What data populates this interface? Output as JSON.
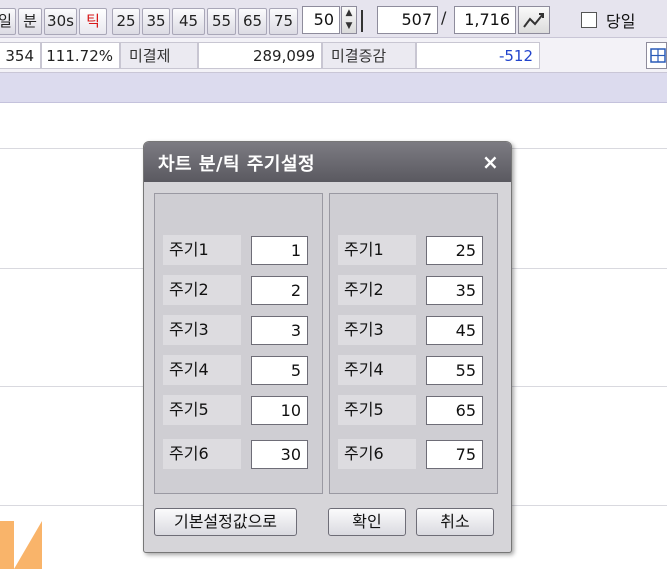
{
  "toolbar": {
    "period_buttons": [
      "일",
      "분",
      "30s",
      "틱",
      "25",
      "35",
      "45",
      "55",
      "65",
      "75"
    ],
    "count_value": "50",
    "current_value": "507",
    "total_value": "1,716",
    "slash": "/",
    "today_label": "당일"
  },
  "info": {
    "cut_value": "354",
    "percent_value": "111.72%",
    "unsettled_label": "미결제",
    "unsettled_value": "289,099",
    "unsettled_change_label": "미결증감",
    "unsettled_change_value": "-512",
    "change_color": "#2244cc"
  },
  "dialog": {
    "title": "차트 분/틱 주기설정",
    "close_symbol": "×",
    "left_rows": [
      {
        "label": "주기1",
        "value": "1"
      },
      {
        "label": "주기2",
        "value": "2"
      },
      {
        "label": "주기3",
        "value": "3"
      },
      {
        "label": "주기4",
        "value": "5"
      },
      {
        "label": "주기5",
        "value": "10"
      },
      {
        "label": "주기6",
        "value": "30"
      }
    ],
    "right_rows": [
      {
        "label": "주기1",
        "value": "25"
      },
      {
        "label": "주기2",
        "value": "35"
      },
      {
        "label": "주기3",
        "value": "45"
      },
      {
        "label": "주기4",
        "value": "55"
      },
      {
        "label": "주기5",
        "value": "65"
      },
      {
        "label": "주기6",
        "value": "75"
      }
    ],
    "reset_label": "기본설정값으로",
    "ok_label": "확인",
    "cancel_label": "취소"
  },
  "icons": [
    "spin-up-icon",
    "spin-down-icon",
    "chart-refresh-icon",
    "grid-icon",
    "close-icon"
  ]
}
